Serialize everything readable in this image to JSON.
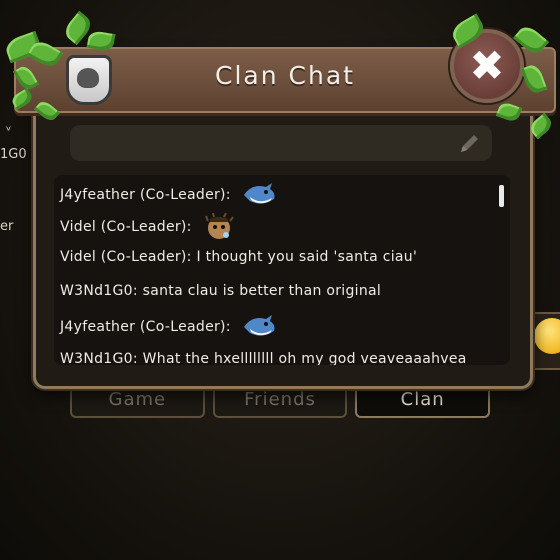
{
  "background": {
    "left_fragments": [
      "ᵛ",
      "1G0",
      "er"
    ]
  },
  "dialog": {
    "title": "Clan Chat",
    "badge_icon": "bear-crest-icon",
    "close_icon": "close-icon",
    "close_symbol": "✖",
    "input": {
      "value": "",
      "placeholder": "",
      "edit_icon": "pencil-icon"
    }
  },
  "messages": [
    {
      "text": "J4yfeather (Co-Leader):",
      "sticker": "shark-sticker"
    },
    {
      "text": "Videl (Co-Leader):",
      "sticker": "pufferfish-sticker"
    },
    {
      "text": "Videl (Co-Leader): I thought you said 'santa ciau'"
    },
    {
      "text": "W3Nd1G0: santa clau is better than original"
    },
    {
      "text": "J4yfeather (Co-Leader):",
      "sticker": "shark-sticker"
    },
    {
      "text": "W3Nd1G0: What the hxellllllll oh my god veaveaaahvea"
    }
  ],
  "tabs": [
    {
      "label": "Game",
      "active": false
    },
    {
      "label": "Friends",
      "active": false
    },
    {
      "label": "Clan",
      "active": true
    }
  ],
  "colors": {
    "header": "#6a4d3a",
    "panel": "#201b14",
    "text": "#f0ece4"
  }
}
